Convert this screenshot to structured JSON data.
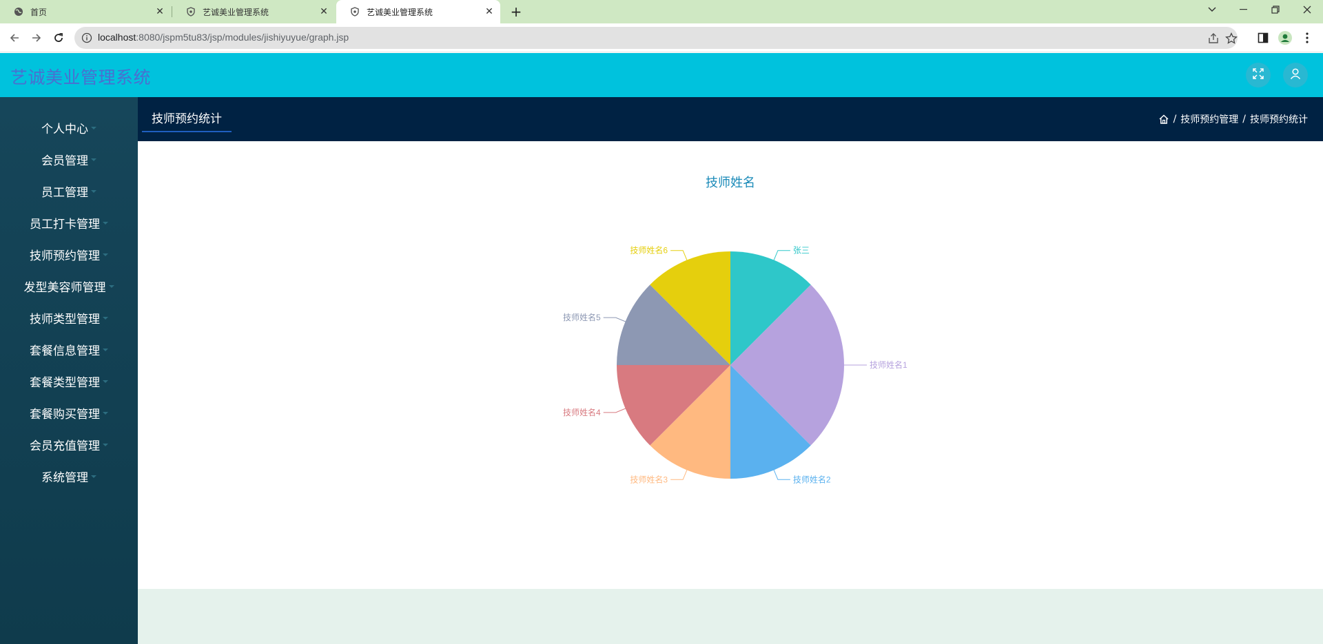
{
  "browser": {
    "tabs": [
      {
        "title": "首页",
        "active": false
      },
      {
        "title": "艺诚美业管理系统",
        "active": false
      },
      {
        "title": "艺诚美业管理系统",
        "active": true
      }
    ],
    "new_tab_label": "+",
    "address": {
      "host": "localhost",
      "path": ":8080/jspm5tu83/jsp/modules/jishiyuyue/graph.jsp"
    }
  },
  "app": {
    "title": "艺诚美业管理系统",
    "header_icons": [
      "fullscreen-icon",
      "user-icon"
    ]
  },
  "sidebar": {
    "items": [
      {
        "label": "个人中心"
      },
      {
        "label": "会员管理"
      },
      {
        "label": "员工管理"
      },
      {
        "label": "员工打卡管理"
      },
      {
        "label": "技师预约管理"
      },
      {
        "label": "发型美容师管理"
      },
      {
        "label": "技师类型管理"
      },
      {
        "label": "套餐信息管理"
      },
      {
        "label": "套餐类型管理"
      },
      {
        "label": "套餐购买管理"
      },
      {
        "label": "会员充值管理"
      },
      {
        "label": "系统管理"
      }
    ]
  },
  "content": {
    "page_tab": "技师预约统计",
    "breadcrumb": {
      "separator": "/",
      "items": [
        "技师预约管理",
        "技师预约统计"
      ]
    }
  },
  "chart_data": {
    "type": "pie",
    "title": "技师姓名",
    "legend": "none",
    "slices": [
      {
        "name": "张三",
        "value": 1,
        "color": "#2ec7c9"
      },
      {
        "name": "技师姓名1",
        "value": 2,
        "color": "#b6a2de"
      },
      {
        "name": "技师姓名2",
        "value": 1,
        "color": "#5ab1ef"
      },
      {
        "name": "技师姓名3",
        "value": 1,
        "color": "#ffb980"
      },
      {
        "name": "技师姓名4",
        "value": 1,
        "color": "#d87a80"
      },
      {
        "name": "技师姓名5",
        "value": 1,
        "color": "#8d98b3"
      },
      {
        "name": "技师姓名6",
        "value": 1,
        "color": "#e5cf0d"
      }
    ]
  }
}
